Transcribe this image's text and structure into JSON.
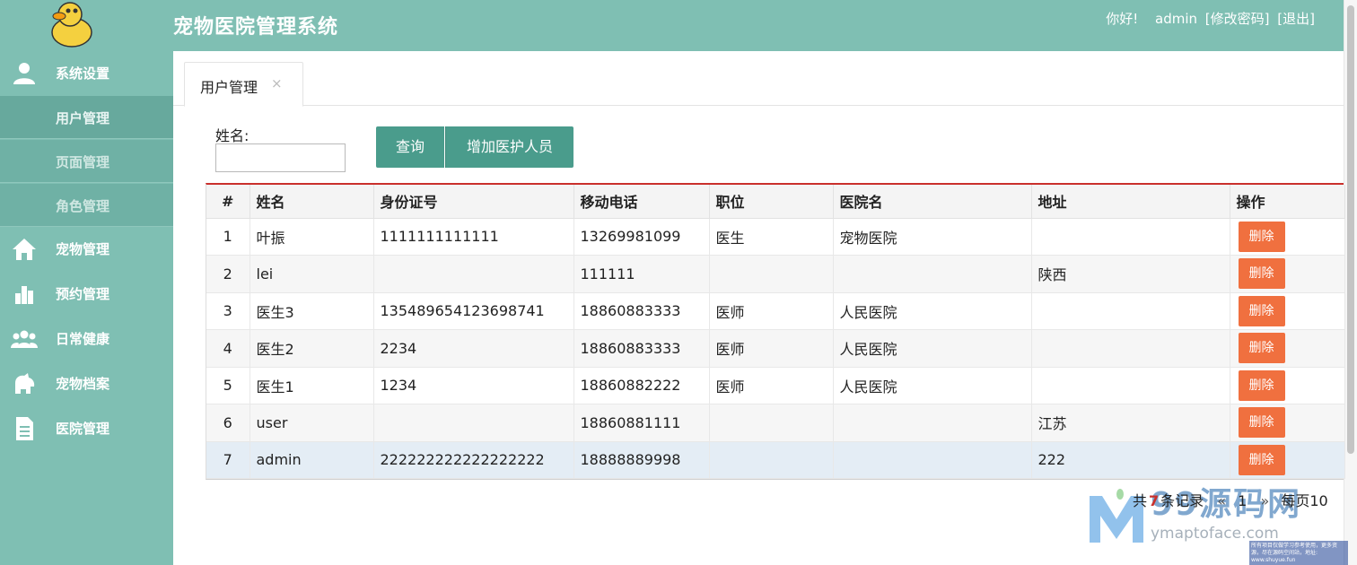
{
  "header": {
    "title": "宠物医院管理系统",
    "greeting": "你好!",
    "username": "admin",
    "change_password": "[修改密码]",
    "logout": "[退出]"
  },
  "sidebar": {
    "items": [
      {
        "label": "系统设置",
        "icon": "user-icon"
      },
      {
        "label": "宠物管理",
        "icon": "home-icon"
      },
      {
        "label": "预约管理",
        "icon": "bar-chart-icon"
      },
      {
        "label": "日常健康",
        "icon": "group-icon"
      },
      {
        "label": "宠物档案",
        "icon": "pet-icon"
      },
      {
        "label": "医院管理",
        "icon": "document-icon"
      }
    ],
    "sub_items": [
      {
        "label": "用户管理"
      },
      {
        "label": "页面管理"
      },
      {
        "label": "角色管理"
      }
    ]
  },
  "tabs": [
    {
      "label": "用户管理",
      "close": "×"
    }
  ],
  "search": {
    "label": "姓名:",
    "value": "",
    "query_button": "查询",
    "add_button": "增加医护人员"
  },
  "table": {
    "headers": [
      "#",
      "姓名",
      "身份证号",
      "移动电话",
      "职位",
      "医院名",
      "地址",
      "操作"
    ],
    "rows": [
      {
        "idx": "1",
        "name": "叶振",
        "id_card": "1111111111111",
        "phone": "13269981099",
        "position": "医生",
        "hospital": "宠物医院",
        "address": "",
        "action": "删除"
      },
      {
        "idx": "2",
        "name": "lei",
        "id_card": "",
        "phone": "111111",
        "position": "",
        "hospital": "",
        "address": "陕西",
        "action": "删除"
      },
      {
        "idx": "3",
        "name": "医生3",
        "id_card": "135489654123698741",
        "phone": "18860883333",
        "position": "医师",
        "hospital": "人民医院",
        "address": "",
        "action": "删除"
      },
      {
        "idx": "4",
        "name": "医生2",
        "id_card": "2234",
        "phone": "18860883333",
        "position": "医师",
        "hospital": "人民医院",
        "address": "",
        "action": "删除"
      },
      {
        "idx": "5",
        "name": "医生1",
        "id_card": "1234",
        "phone": "18860882222",
        "position": "医师",
        "hospital": "人民医院",
        "address": "",
        "action": "删除"
      },
      {
        "idx": "6",
        "name": "user",
        "id_card": "",
        "phone": "18860881111",
        "position": "",
        "hospital": "",
        "address": "江苏",
        "action": "删除"
      },
      {
        "idx": "7",
        "name": "admin",
        "id_card": "222222222222222222",
        "phone": "18888889998",
        "position": "",
        "hospital": "",
        "address": "222",
        "action": "删除"
      }
    ]
  },
  "pagination": {
    "prefix": "共",
    "total": "7",
    "suffix": "条记录",
    "prev": "«",
    "page": "1",
    "next": "»",
    "per_page": "每页10"
  },
  "watermark": {
    "brand": "99源码网",
    "site": "ymaptoface.com",
    "note": "所有项目仅做学习参考使用，更多资源，尽在源码空间站，地址: www.shuyue.fun"
  },
  "colors": {
    "theme": "#7fbfb3",
    "button": "#4a9c8c",
    "delete": "#f0703f",
    "table_top_border": "#c9302c"
  }
}
